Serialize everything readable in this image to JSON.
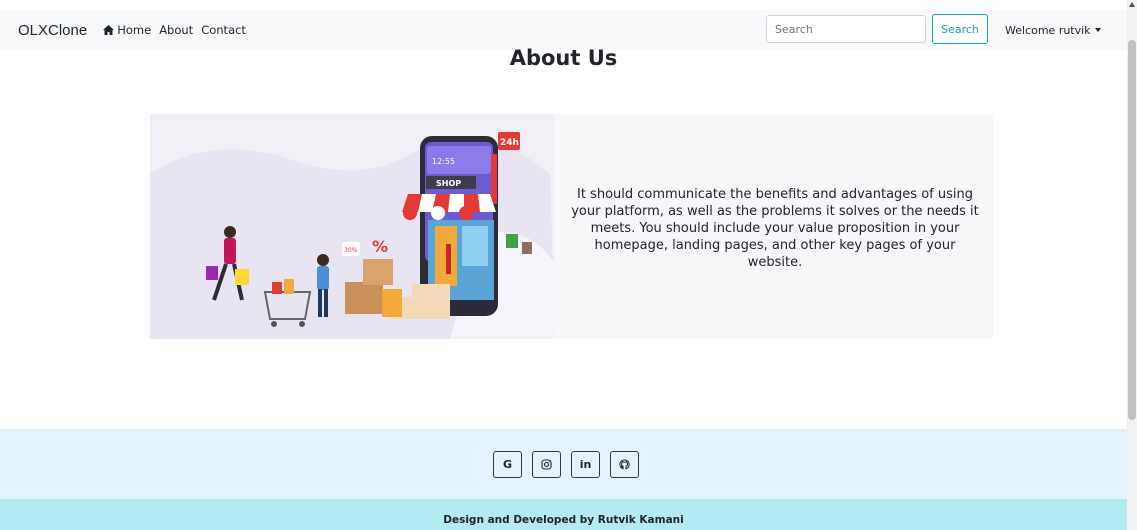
{
  "navbar": {
    "brand": "OLXClone",
    "links": [
      {
        "label": "Home",
        "icon": "home-icon"
      },
      {
        "label": "About"
      },
      {
        "label": "Contact"
      }
    ],
    "search": {
      "placeholder": "Search",
      "value": "",
      "button_label": "Search"
    },
    "user_menu": {
      "label": "Welcome rutvik"
    }
  },
  "main": {
    "title": "About Us",
    "description": "It should communicate the benefits and advantages of using your platform, as well as the problems it solves or the needs it meets. You should include your value proposition in your homepage, landing pages, and other key pages of your website.",
    "illustration": {
      "shop_sign": "SHOP",
      "badge": "24h",
      "phone_time": "12:55",
      "tag": "30%",
      "percent": "%"
    }
  },
  "footer": {
    "social": [
      {
        "label": "G",
        "icon": "google-icon"
      },
      {
        "label": "",
        "icon": "instagram-icon"
      },
      {
        "label": "in",
        "icon": "linkedin-icon"
      },
      {
        "label": "",
        "icon": "github-icon"
      }
    ],
    "credit": "Design and Developed by Rutvik Kamani"
  },
  "colors": {
    "navbar_bg": "#f8f9fa",
    "search_button": "#17a2b8",
    "footer_top": "#e3f2fd",
    "footer_bottom": "#b2ebf2"
  }
}
